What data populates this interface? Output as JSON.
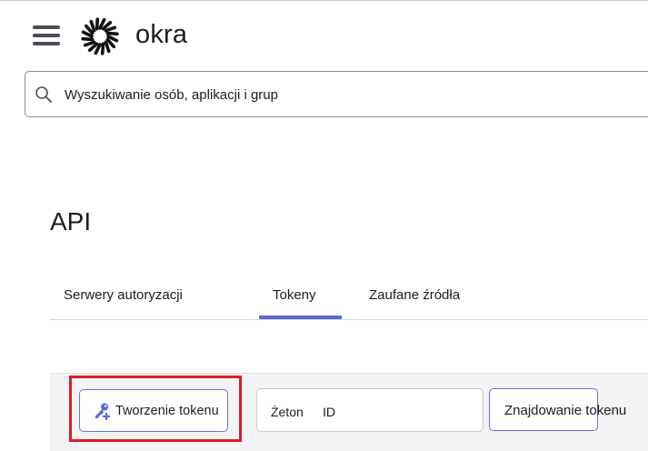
{
  "header": {
    "brand": "okra",
    "search_placeholder": "Wyszukiwanie osób, aplikacji i grup"
  },
  "page": {
    "title": "API"
  },
  "tabs": [
    {
      "label": "Serwery autoryzacji",
      "active": false
    },
    {
      "label": "Tokeny",
      "active": true
    },
    {
      "label": "Zaufane źródła",
      "active": false
    }
  ],
  "toolbar": {
    "create_label": "Tworzenie tokenu",
    "token_field_label": "Żeton",
    "token_field_value": "ID",
    "find_label": "Znajdowanie tokenu"
  },
  "colors": {
    "accent": "#5b68d6",
    "highlight": "#e01b24",
    "text": "#1d1d21"
  },
  "icons": {
    "menu": "hamburger-menu-icon",
    "logo": "sunburst-logo-icon",
    "search": "search-icon",
    "create": "key-plus-icon"
  }
}
